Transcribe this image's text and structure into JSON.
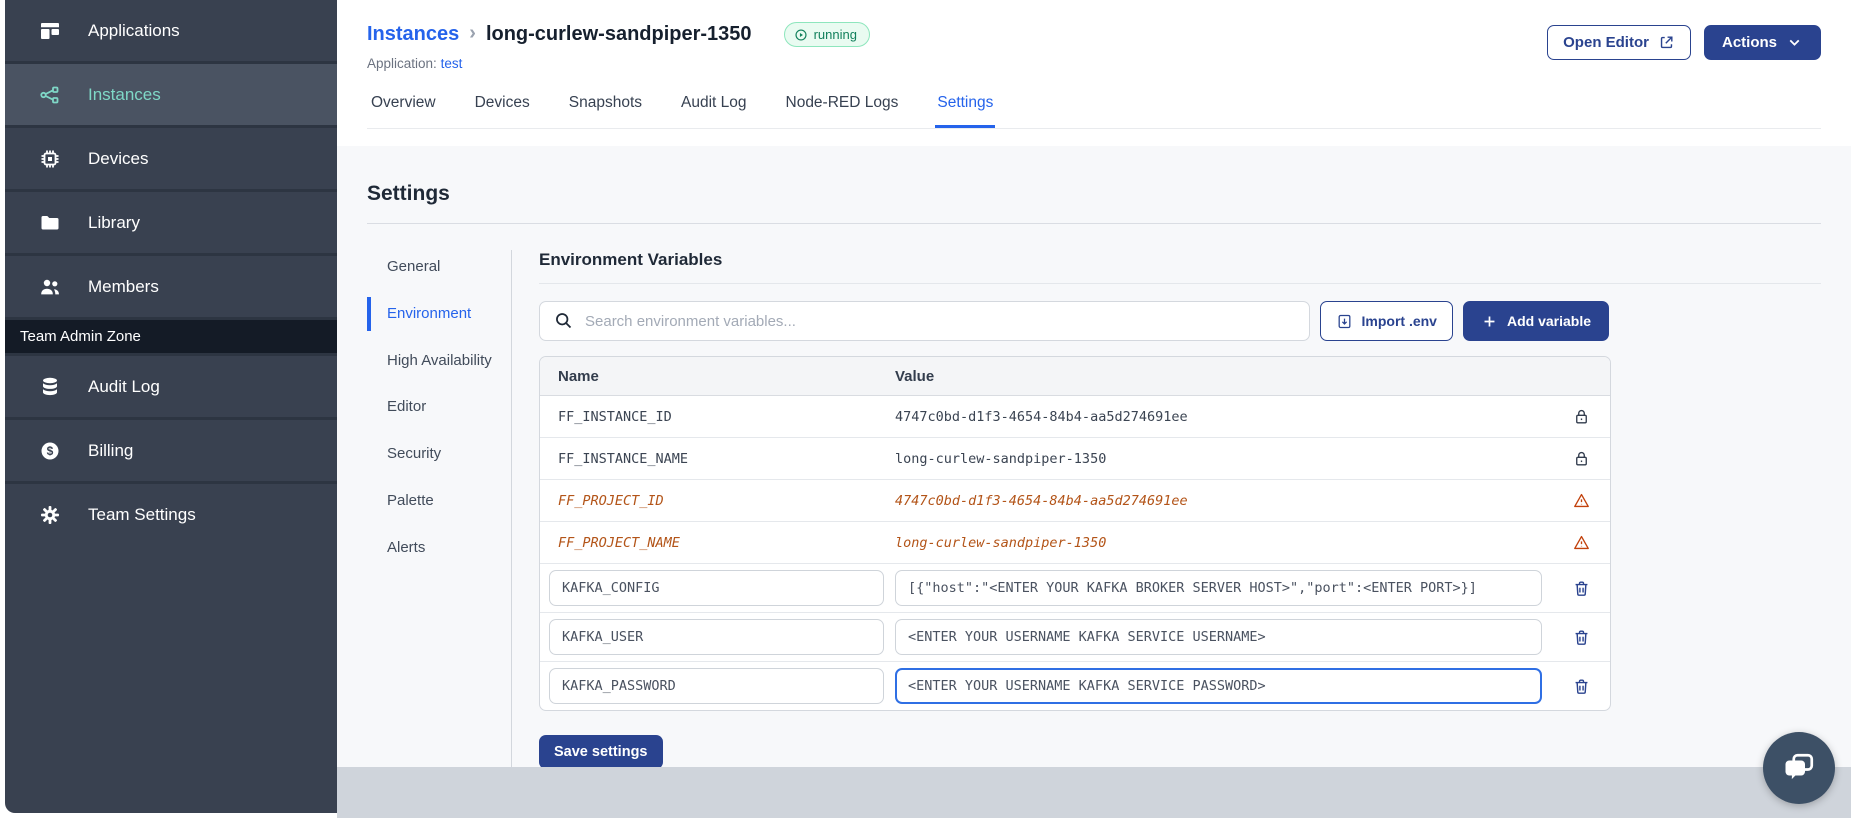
{
  "sidebar": {
    "items": [
      {
        "label": "Applications",
        "active": false
      },
      {
        "label": "Instances",
        "active": true
      },
      {
        "label": "Devices",
        "active": false
      },
      {
        "label": "Library",
        "active": false
      },
      {
        "label": "Members",
        "active": false
      }
    ],
    "section_label": "Team Admin Zone",
    "admin_items": [
      {
        "label": "Audit Log"
      },
      {
        "label": "Billing"
      },
      {
        "label": "Team Settings"
      }
    ]
  },
  "header": {
    "breadcrumb_parent": "Instances",
    "breadcrumb_separator": "›",
    "instance_name": "long-curlew-sandpiper-1350",
    "status_badge": "running",
    "application_label": "Application:",
    "application_name": "test",
    "open_editor_label": "Open Editor",
    "actions_label": "Actions"
  },
  "tabs": [
    {
      "label": "Overview",
      "active": false
    },
    {
      "label": "Devices",
      "active": false
    },
    {
      "label": "Snapshots",
      "active": false
    },
    {
      "label": "Audit Log",
      "active": false
    },
    {
      "label": "Node-RED Logs",
      "active": false
    },
    {
      "label": "Settings",
      "active": true
    }
  ],
  "settings": {
    "title": "Settings",
    "nav": [
      {
        "label": "General",
        "active": false
      },
      {
        "label": "Environment",
        "active": true
      },
      {
        "label": "High Availability",
        "active": false
      },
      {
        "label": "Editor",
        "active": false
      },
      {
        "label": "Security",
        "active": false
      },
      {
        "label": "Palette",
        "active": false
      },
      {
        "label": "Alerts",
        "active": false
      }
    ],
    "section_title": "Environment Variables",
    "search_placeholder": "Search environment variables...",
    "import_button_label": "Import .env",
    "add_button_label": "Add variable",
    "save_button_label": "Save settings",
    "table": {
      "columns": [
        "Name",
        "Value"
      ],
      "rows": [
        {
          "name": "FF_INSTANCE_ID",
          "value": "4747c0bd-d1f3-4654-84b4-aa5d274691ee",
          "state": "locked"
        },
        {
          "name": "FF_INSTANCE_NAME",
          "value": "long-curlew-sandpiper-1350",
          "state": "locked"
        },
        {
          "name": "FF_PROJECT_ID",
          "value": "4747c0bd-d1f3-4654-84b4-aa5d274691ee",
          "state": "deprecated"
        },
        {
          "name": "FF_PROJECT_NAME",
          "value": "long-curlew-sandpiper-1350",
          "state": "deprecated"
        },
        {
          "name": "KAFKA_CONFIG",
          "value": "[{\"host\":\"<ENTER YOUR KAFKA BROKER SERVER HOST>\",\"port\":<ENTER PORT>}]",
          "state": "editable"
        },
        {
          "name": "KAFKA_USER",
          "value": "<ENTER YOUR USERNAME KAFKA SERVICE USERNAME>",
          "state": "editable"
        },
        {
          "name": "KAFKA_PASSWORD",
          "value": "<ENTER YOUR USERNAME KAFKA SERVICE PASSWORD>",
          "state": "editable",
          "focused": true
        }
      ]
    }
  },
  "colors": {
    "sidebar_bg": "#394150",
    "sidebar_active_bg": "#4a5362",
    "sidebar_active_text": "#7fd8c7",
    "admin_zone_bg": "#141b26",
    "navy_accent": "#2a438f",
    "link_blue": "#2563eb",
    "running_badge_text": "#12805c",
    "running_badge_bg": "#e9fbf1",
    "deprecated_text": "#b35418",
    "warning_icon": "#c2410c",
    "content_bg": "#f7f8fa",
    "footer_band": "#cfd4db",
    "chat_bubble_bg": "#3d5066"
  }
}
